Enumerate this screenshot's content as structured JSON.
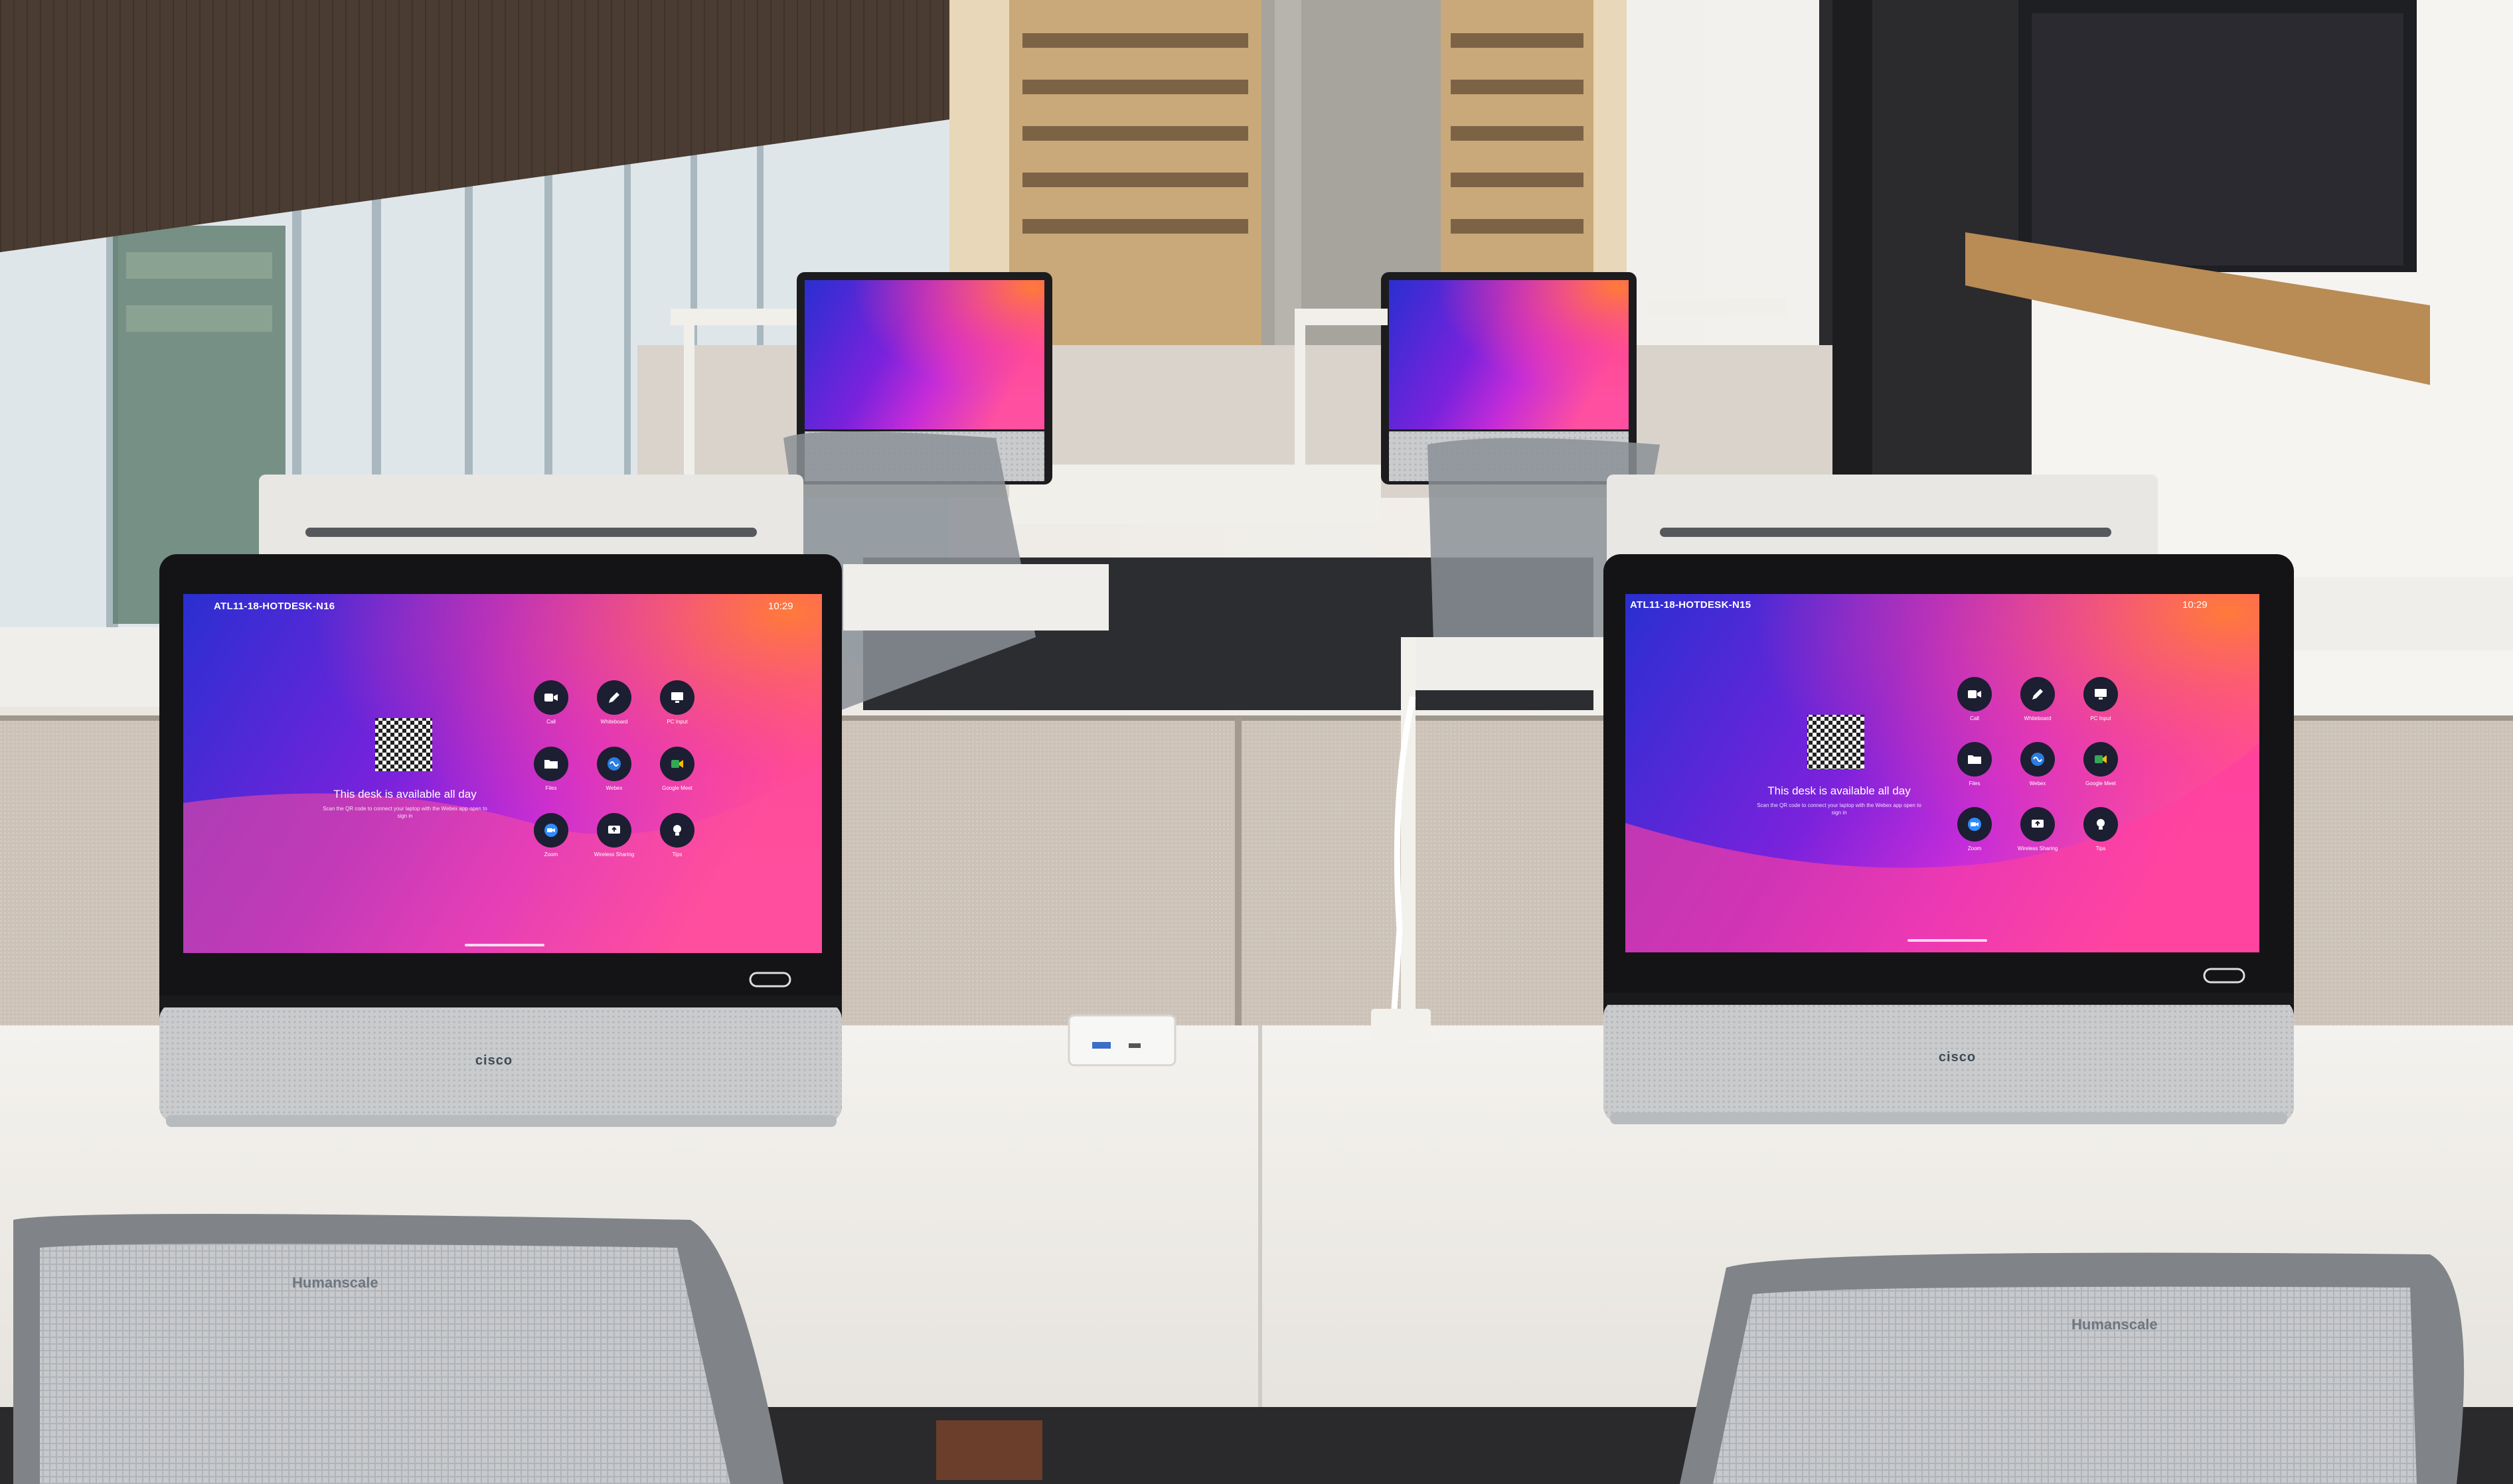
{
  "scene": "hot desk office with two Cisco desk displays",
  "screens": [
    {
      "title": "ATL11-18-HOTDESK-N16",
      "time": "10:29",
      "availability": "This desk is available all day",
      "instructions": "Scan the QR code to connect your laptop with the Webex app open to sign in",
      "apps": [
        {
          "label": "Call",
          "icon": "camera-icon"
        },
        {
          "label": "Whiteboard",
          "icon": "pencil-icon"
        },
        {
          "label": "PC Input",
          "icon": "monitor-icon"
        },
        {
          "label": "Files",
          "icon": "folder-icon"
        },
        {
          "label": "Webex",
          "icon": "webex-icon"
        },
        {
          "label": "Google Meet",
          "icon": "meet-icon"
        },
        {
          "label": "Zoom",
          "icon": "zoom-icon"
        },
        {
          "label": "Wireless Sharing",
          "icon": "share-icon"
        },
        {
          "label": "Tips",
          "icon": "lightbulb-icon"
        }
      ]
    },
    {
      "title": "ATL11-18-HOTDESK-N15",
      "time": "10:29",
      "availability": "This desk is available all day",
      "instructions": "Scan the QR code to connect your laptop with the Webex app open to sign in",
      "apps": [
        {
          "label": "Call",
          "icon": "camera-icon"
        },
        {
          "label": "Whiteboard",
          "icon": "pencil-icon"
        },
        {
          "label": "PC Input",
          "icon": "monitor-icon"
        },
        {
          "label": "Files",
          "icon": "folder-icon"
        },
        {
          "label": "Webex",
          "icon": "webex-icon"
        },
        {
          "label": "Google Meet",
          "icon": "meet-icon"
        },
        {
          "label": "Zoom",
          "icon": "zoom-icon"
        },
        {
          "label": "Wireless Sharing",
          "icon": "share-icon"
        },
        {
          "label": "Tips",
          "icon": "lightbulb-icon"
        }
      ]
    }
  ],
  "brand": "cisco",
  "chair_brand": "Humanscale",
  "colors": {
    "screen_left": "#2a2fd0",
    "screen_mid": "#9020d8",
    "screen_hot": "#ff3fa2",
    "screen_orange": "#ff6a3d",
    "fabric": "#cbbfb3",
    "desk": "#f2f0ec"
  }
}
